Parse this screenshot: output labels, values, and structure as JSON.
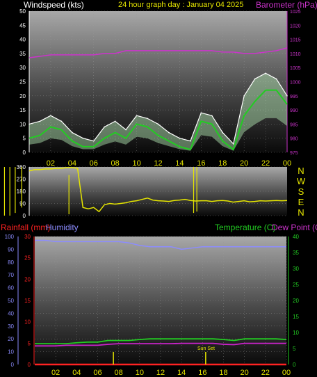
{
  "header": {
    "title": "24 hour graph day : January 04 2025",
    "wind_title": "Windspeed (kts)",
    "baro_title": "Barometer (hPa)"
  },
  "lower_header": {
    "rain_title": "Rainfall (mm)",
    "humidity_title": "Humidity",
    "temp_title": "Temperature (C)",
    "dew_title": "Dew Point (C)"
  },
  "colors": {
    "wind_gust": "#ffffff",
    "wind_avg": "#22cc22",
    "wind_fill": "#b8f0b8",
    "barometer": "#cc33cc",
    "direction": "#e6e600",
    "humidity": "#8c8cff",
    "temperature": "#22cc22",
    "dewpoint": "#cc22cc",
    "rain": "#ff2222",
    "sunmark": "#e6e600"
  },
  "direction_compass": [
    "N",
    "W",
    "S",
    "E",
    "N"
  ],
  "sun_set_label": "Sun Set",
  "chart_data": [
    {
      "type": "line",
      "name": "wind-barometer",
      "xlabel": "",
      "x_ticks": [
        "02",
        "04",
        "06",
        "08",
        "10",
        "12",
        "14",
        "16",
        "18",
        "20",
        "22",
        "00"
      ],
      "ylabel": "Windspeed (kts)",
      "ylim": [
        0,
        50
      ],
      "y_ticks": [
        0,
        5,
        10,
        15,
        20,
        25,
        30,
        35,
        40,
        45,
        50
      ],
      "y2label": "Barometer (hPa)",
      "y2lim": [
        975,
        1025
      ],
      "y2_ticks": [
        975,
        980,
        985,
        990,
        995,
        1000,
        1005,
        1010,
        1015,
        1020,
        1025
      ],
      "grid": true,
      "x": [
        0,
        1,
        2,
        3,
        4,
        5,
        6,
        7,
        8,
        9,
        10,
        11,
        12,
        13,
        14,
        15,
        16,
        17,
        18,
        19,
        20,
        21,
        22,
        23,
        24
      ],
      "series": [
        {
          "name": "Windspeed gust",
          "values": [
            10,
            11,
            13,
            11,
            7,
            5,
            4,
            9,
            11,
            8,
            13,
            12,
            10,
            7,
            5,
            4,
            14,
            13,
            7,
            3,
            20,
            26,
            28,
            26,
            20
          ]
        },
        {
          "name": "Windspeed avg",
          "values": [
            5,
            6,
            9,
            8,
            4,
            2,
            2,
            5,
            7,
            5,
            10,
            9,
            6,
            4,
            2,
            1,
            11,
            10,
            4,
            1,
            13,
            18,
            22,
            22,
            17
          ]
        },
        {
          "name": "Barometer",
          "values": [
            1008.5,
            1009,
            1009.5,
            1009.5,
            1009.5,
            1009.5,
            1009.5,
            1010,
            1010,
            1011,
            1011,
            1011,
            1011,
            1011,
            1011,
            1011,
            1011,
            1011,
            1010.5,
            1010.5,
            1010,
            1010,
            1010.5,
            1011,
            1012
          ]
        }
      ]
    },
    {
      "type": "line",
      "name": "wind-direction",
      "ylim": [
        0,
        360
      ],
      "y_ticks": [
        0,
        90,
        180,
        270,
        360
      ],
      "grid": true,
      "x": [
        0,
        0.5,
        1,
        1.5,
        2,
        2.5,
        3,
        3.5,
        4,
        4.5,
        5,
        5.5,
        6,
        6.5,
        7,
        7.5,
        8,
        8.5,
        9,
        9.5,
        10,
        10.5,
        11,
        11.5,
        12,
        12.5,
        13,
        13.5,
        14,
        14.5,
        15,
        15.5,
        16,
        16.5,
        17,
        17.5,
        18,
        18.5,
        19,
        19.5,
        20,
        20.5,
        21,
        21.5,
        22,
        22.5,
        23,
        23.5,
        24
      ],
      "series": [
        {
          "name": "Wind direction",
          "values": [
            330,
            340,
            340,
            345,
            345,
            350,
            350,
            355,
            355,
            350,
            60,
            50,
            60,
            30,
            80,
            90,
            85,
            90,
            95,
            105,
            110,
            120,
            130,
            115,
            110,
            108,
            105,
            112,
            115,
            120,
            112,
            108,
            110,
            110,
            105,
            110,
            112,
            108,
            100,
            105,
            110,
            102,
            105,
            110,
            108,
            110,
            112,
            110,
            112
          ]
        }
      ]
    },
    {
      "type": "line",
      "name": "temp-humidity-rain",
      "x_ticks": [
        "02",
        "04",
        "06",
        "08",
        "10",
        "12",
        "14",
        "16",
        "18",
        "20",
        "22",
        "00"
      ],
      "y_left_rain_ticks": [
        0,
        5,
        10,
        15,
        20,
        25,
        30
      ],
      "y_left_humidity_ticks": [
        0,
        10,
        20,
        30,
        40,
        50,
        60,
        70,
        80,
        90,
        100
      ],
      "y_right_temp_ticks": [
        0,
        5,
        10,
        15,
        20,
        25,
        30,
        35,
        40
      ],
      "rain_lim": [
        0,
        30
      ],
      "humidity_lim": [
        0,
        100
      ],
      "temp_lim": [
        0,
        40
      ],
      "grid": true,
      "x": [
        0,
        1,
        2,
        3,
        4,
        5,
        6,
        7,
        8,
        9,
        10,
        11,
        12,
        13,
        14,
        15,
        16,
        17,
        18,
        19,
        20,
        21,
        22,
        23,
        24
      ],
      "series": [
        {
          "name": "Humidity",
          "values": [
            97,
            97,
            96,
            96,
            96,
            96,
            96,
            96,
            96,
            95,
            93,
            92,
            92,
            92,
            90,
            91,
            92,
            92,
            92,
            92,
            92,
            92,
            92,
            92,
            92
          ]
        },
        {
          "name": "Temperature",
          "values": [
            6.5,
            6.5,
            6.5,
            6.5,
            6.8,
            7,
            7,
            7.5,
            7.5,
            7.5,
            7.8,
            8,
            8,
            8,
            8,
            8,
            8,
            8,
            7.8,
            7.5,
            8,
            8,
            8,
            8,
            7.8
          ]
        },
        {
          "name": "Dew Point",
          "values": [
            5.8,
            5.8,
            5.8,
            6,
            6,
            6,
            6,
            6.3,
            6.5,
            6.5,
            6.5,
            6.5,
            6.5,
            6.5,
            6.6,
            6.6,
            6.6,
            6.6,
            6.3,
            6.2,
            6.6,
            6.6,
            6.6,
            6.6,
            6.6
          ]
        },
        {
          "name": "Rainfall",
          "values": [
            0,
            0,
            0,
            0,
            0,
            0,
            0,
            0,
            0,
            0,
            0,
            0,
            0,
            0,
            0,
            0,
            0,
            0,
            0,
            0,
            0,
            0,
            0,
            0,
            0
          ]
        }
      ],
      "sun_marks": [
        7.5,
        16.3
      ]
    }
  ]
}
